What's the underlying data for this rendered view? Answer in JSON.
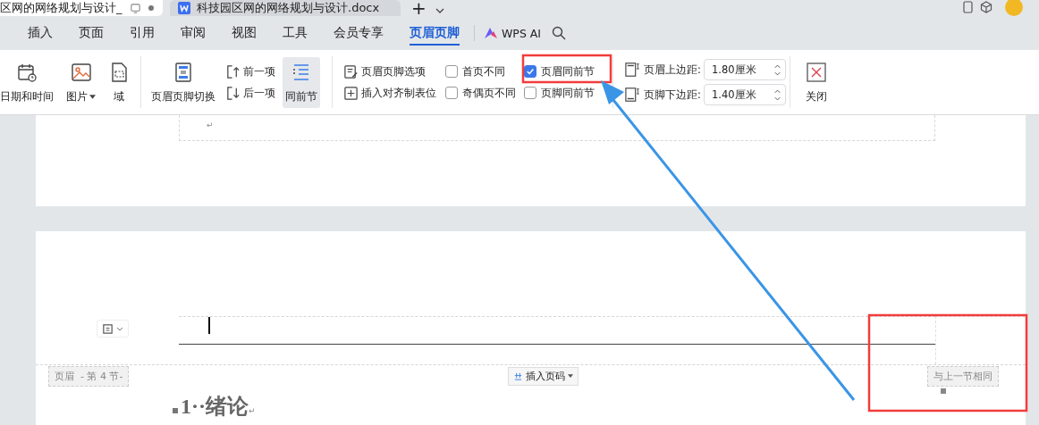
{
  "document_tabs": [
    {
      "title": "区网的网络规划与设计_",
      "selected": false
    },
    {
      "title": "科技园区网的网络规划与设计.docx",
      "selected": true
    }
  ],
  "new_tab": "+",
  "menu": [
    {
      "label": "插入",
      "selected": false
    },
    {
      "label": "页面",
      "selected": false
    },
    {
      "label": "引用",
      "selected": false
    },
    {
      "label": "审阅",
      "selected": false
    },
    {
      "label": "视图",
      "selected": false
    },
    {
      "label": "工具",
      "selected": false
    },
    {
      "label": "会员专享",
      "selected": false
    },
    {
      "label": "页眉页脚",
      "selected": true
    }
  ],
  "ai_button": "WPS AI",
  "ribbon": {
    "insert_buttons": [
      {
        "kind": "calendar",
        "label": "日期和时间",
        "dropdown": false
      },
      {
        "kind": "image",
        "label": "图片",
        "dropdown": true
      },
      {
        "kind": "field",
        "label": "域",
        "dropdown": false
      }
    ],
    "switch_button": "页眉页脚切换",
    "nav_buttons": [
      {
        "kind": "prev",
        "label": "前一项"
      },
      {
        "kind": "next",
        "label": "后一项"
      }
    ],
    "link_button": {
      "label": "同前节",
      "selected": true
    },
    "option_buttons": [
      {
        "kind": "options",
        "label": "页眉页脚选项"
      },
      {
        "kind": "tab",
        "label": "插入对齐制表位"
      }
    ],
    "checkboxes": [
      {
        "label": "首页不同",
        "checked": false
      },
      {
        "label": "奇偶页不同",
        "checked": false
      },
      {
        "label": "页眉同前节",
        "checked": true
      },
      {
        "label": "页脚同前节",
        "checked": false
      }
    ],
    "margins": [
      {
        "label": "页眉上边距:",
        "value": "1.80厘米"
      },
      {
        "label": "页脚下边距:",
        "value": "1.40厘米"
      }
    ],
    "close_button": "关闭"
  },
  "document": {
    "page1_mark": "↵",
    "header_label": "页眉  - 第 4 节-",
    "insert_page_number": "插入页码",
    "same_as_previous": "与上一节相同",
    "heading": "1··绪论",
    "heading_mark": "↵"
  }
}
